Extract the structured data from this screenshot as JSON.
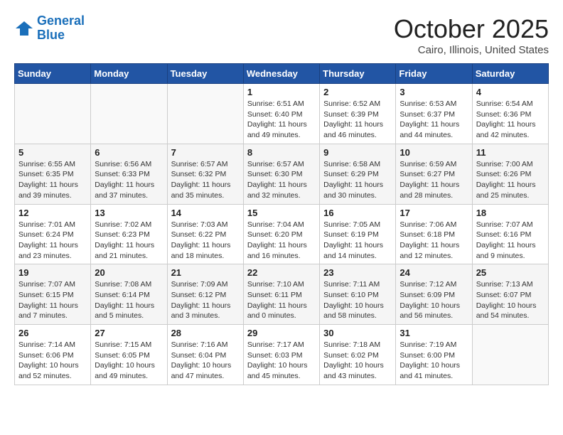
{
  "header": {
    "logo_line1": "General",
    "logo_line2": "Blue",
    "month": "October 2025",
    "location": "Cairo, Illinois, United States"
  },
  "weekdays": [
    "Sunday",
    "Monday",
    "Tuesday",
    "Wednesday",
    "Thursday",
    "Friday",
    "Saturday"
  ],
  "weeks": [
    [
      {
        "day": "",
        "info": ""
      },
      {
        "day": "",
        "info": ""
      },
      {
        "day": "",
        "info": ""
      },
      {
        "day": "1",
        "info": "Sunrise: 6:51 AM\nSunset: 6:40 PM\nDaylight: 11 hours\nand 49 minutes."
      },
      {
        "day": "2",
        "info": "Sunrise: 6:52 AM\nSunset: 6:39 PM\nDaylight: 11 hours\nand 46 minutes."
      },
      {
        "day": "3",
        "info": "Sunrise: 6:53 AM\nSunset: 6:37 PM\nDaylight: 11 hours\nand 44 minutes."
      },
      {
        "day": "4",
        "info": "Sunrise: 6:54 AM\nSunset: 6:36 PM\nDaylight: 11 hours\nand 42 minutes."
      }
    ],
    [
      {
        "day": "5",
        "info": "Sunrise: 6:55 AM\nSunset: 6:35 PM\nDaylight: 11 hours\nand 39 minutes."
      },
      {
        "day": "6",
        "info": "Sunrise: 6:56 AM\nSunset: 6:33 PM\nDaylight: 11 hours\nand 37 minutes."
      },
      {
        "day": "7",
        "info": "Sunrise: 6:57 AM\nSunset: 6:32 PM\nDaylight: 11 hours\nand 35 minutes."
      },
      {
        "day": "8",
        "info": "Sunrise: 6:57 AM\nSunset: 6:30 PM\nDaylight: 11 hours\nand 32 minutes."
      },
      {
        "day": "9",
        "info": "Sunrise: 6:58 AM\nSunset: 6:29 PM\nDaylight: 11 hours\nand 30 minutes."
      },
      {
        "day": "10",
        "info": "Sunrise: 6:59 AM\nSunset: 6:27 PM\nDaylight: 11 hours\nand 28 minutes."
      },
      {
        "day": "11",
        "info": "Sunrise: 7:00 AM\nSunset: 6:26 PM\nDaylight: 11 hours\nand 25 minutes."
      }
    ],
    [
      {
        "day": "12",
        "info": "Sunrise: 7:01 AM\nSunset: 6:24 PM\nDaylight: 11 hours\nand 23 minutes."
      },
      {
        "day": "13",
        "info": "Sunrise: 7:02 AM\nSunset: 6:23 PM\nDaylight: 11 hours\nand 21 minutes."
      },
      {
        "day": "14",
        "info": "Sunrise: 7:03 AM\nSunset: 6:22 PM\nDaylight: 11 hours\nand 18 minutes."
      },
      {
        "day": "15",
        "info": "Sunrise: 7:04 AM\nSunset: 6:20 PM\nDaylight: 11 hours\nand 16 minutes."
      },
      {
        "day": "16",
        "info": "Sunrise: 7:05 AM\nSunset: 6:19 PM\nDaylight: 11 hours\nand 14 minutes."
      },
      {
        "day": "17",
        "info": "Sunrise: 7:06 AM\nSunset: 6:18 PM\nDaylight: 11 hours\nand 12 minutes."
      },
      {
        "day": "18",
        "info": "Sunrise: 7:07 AM\nSunset: 6:16 PM\nDaylight: 11 hours\nand 9 minutes."
      }
    ],
    [
      {
        "day": "19",
        "info": "Sunrise: 7:07 AM\nSunset: 6:15 PM\nDaylight: 11 hours\nand 7 minutes."
      },
      {
        "day": "20",
        "info": "Sunrise: 7:08 AM\nSunset: 6:14 PM\nDaylight: 11 hours\nand 5 minutes."
      },
      {
        "day": "21",
        "info": "Sunrise: 7:09 AM\nSunset: 6:12 PM\nDaylight: 11 hours\nand 3 minutes."
      },
      {
        "day": "22",
        "info": "Sunrise: 7:10 AM\nSunset: 6:11 PM\nDaylight: 11 hours\nand 0 minutes."
      },
      {
        "day": "23",
        "info": "Sunrise: 7:11 AM\nSunset: 6:10 PM\nDaylight: 10 hours\nand 58 minutes."
      },
      {
        "day": "24",
        "info": "Sunrise: 7:12 AM\nSunset: 6:09 PM\nDaylight: 10 hours\nand 56 minutes."
      },
      {
        "day": "25",
        "info": "Sunrise: 7:13 AM\nSunset: 6:07 PM\nDaylight: 10 hours\nand 54 minutes."
      }
    ],
    [
      {
        "day": "26",
        "info": "Sunrise: 7:14 AM\nSunset: 6:06 PM\nDaylight: 10 hours\nand 52 minutes."
      },
      {
        "day": "27",
        "info": "Sunrise: 7:15 AM\nSunset: 6:05 PM\nDaylight: 10 hours\nand 49 minutes."
      },
      {
        "day": "28",
        "info": "Sunrise: 7:16 AM\nSunset: 6:04 PM\nDaylight: 10 hours\nand 47 minutes."
      },
      {
        "day": "29",
        "info": "Sunrise: 7:17 AM\nSunset: 6:03 PM\nDaylight: 10 hours\nand 45 minutes."
      },
      {
        "day": "30",
        "info": "Sunrise: 7:18 AM\nSunset: 6:02 PM\nDaylight: 10 hours\nand 43 minutes."
      },
      {
        "day": "31",
        "info": "Sunrise: 7:19 AM\nSunset: 6:00 PM\nDaylight: 10 hours\nand 41 minutes."
      },
      {
        "day": "",
        "info": ""
      }
    ]
  ]
}
